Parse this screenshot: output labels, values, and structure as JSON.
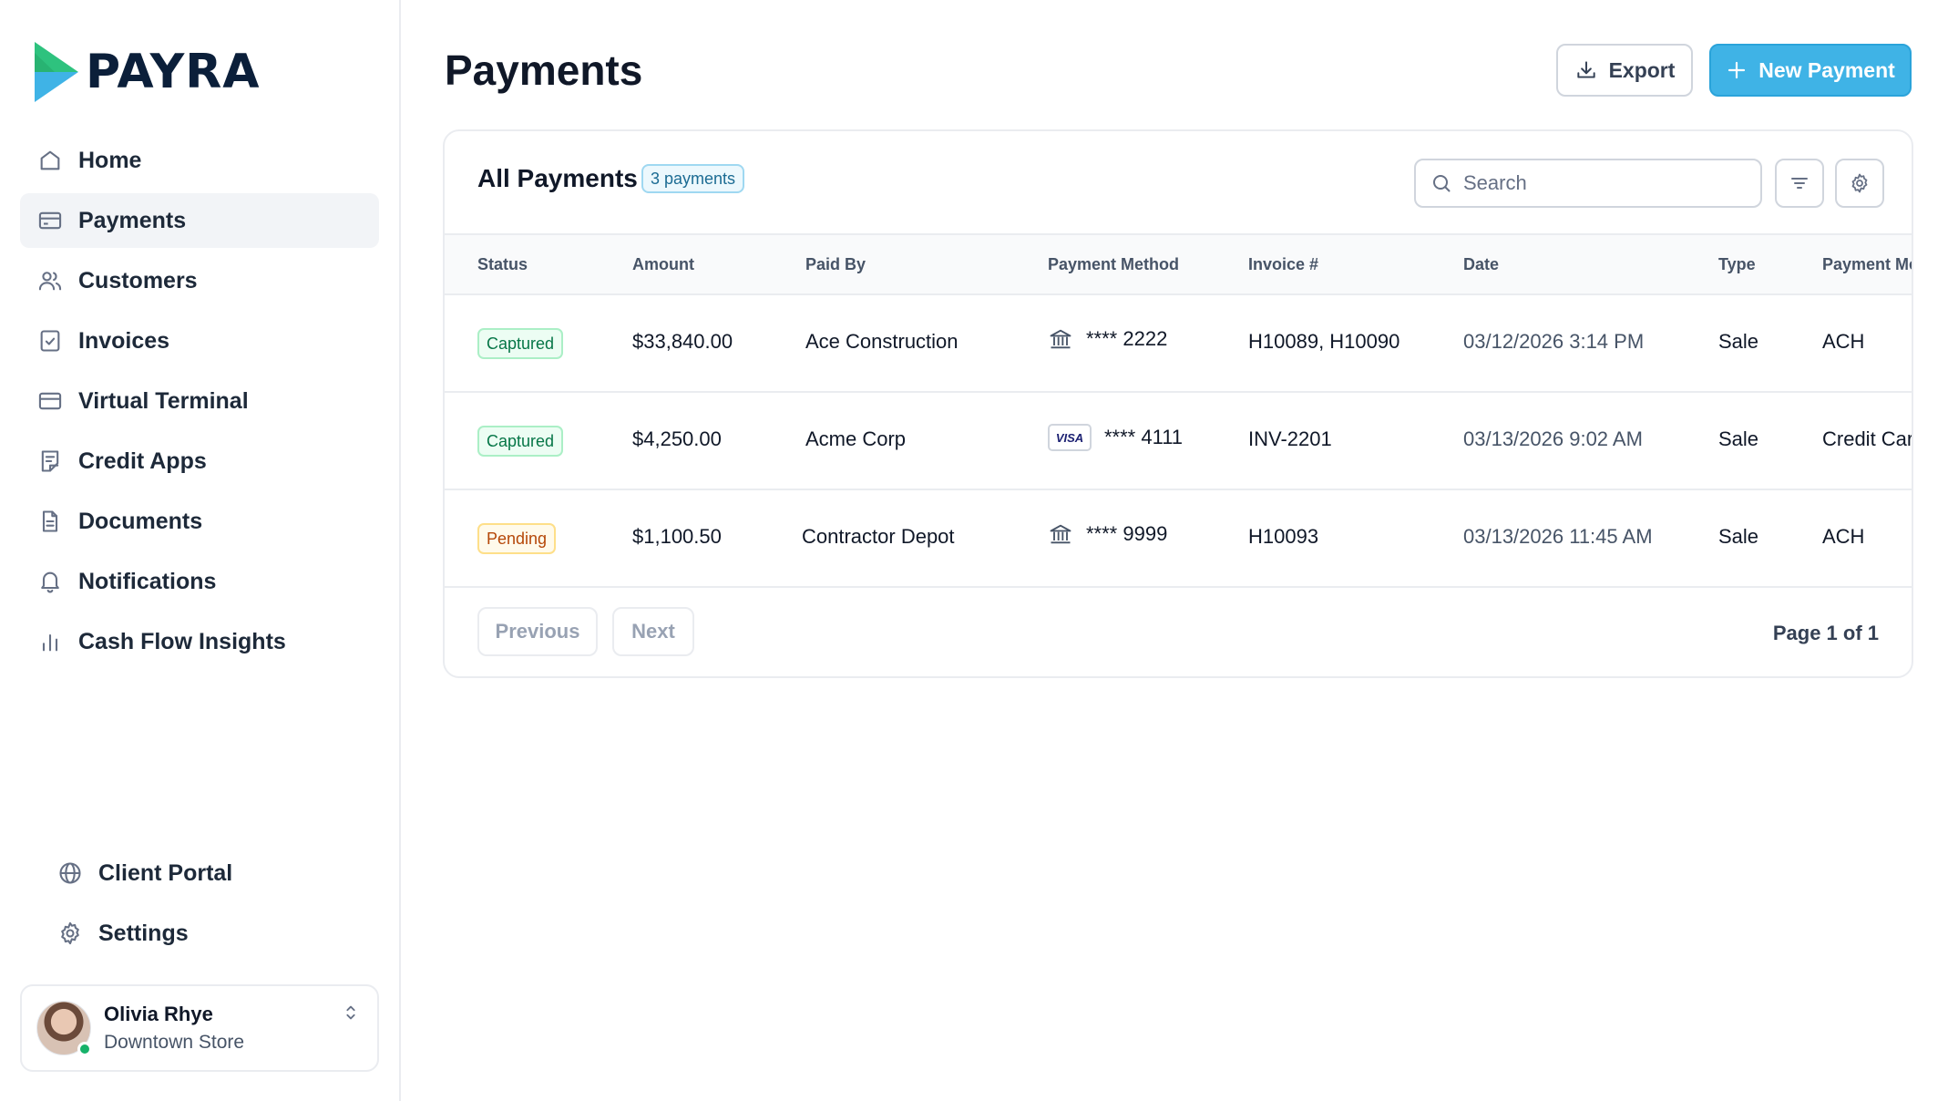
{
  "brand": {
    "name": "PAYRA",
    "accent": "#3fb3e6",
    "logo_green": "#2ec27e"
  },
  "sidebar": {
    "items": [
      {
        "label": "Home",
        "icon": "home-icon"
      },
      {
        "label": "Payments",
        "icon": "card-icon",
        "active": true
      },
      {
        "label": "Customers",
        "icon": "users-icon"
      },
      {
        "label": "Invoices",
        "icon": "invoice-check-icon"
      },
      {
        "label": "Virtual Terminal",
        "icon": "terminal-card-icon"
      },
      {
        "label": "Credit Apps",
        "icon": "credit-app-icon"
      },
      {
        "label": "Documents",
        "icon": "document-icon"
      },
      {
        "label": "Notifications",
        "icon": "bell-icon"
      },
      {
        "label": "Cash Flow Insights",
        "icon": "bar-chart-icon"
      }
    ],
    "bottom_items": [
      {
        "label": "Client Portal",
        "icon": "globe-icon"
      },
      {
        "label": "Settings",
        "icon": "gear-icon"
      }
    ],
    "user": {
      "name": "Olivia Rhye",
      "store": "Downtown Store",
      "status": "online"
    }
  },
  "header": {
    "title": "Payments",
    "export_label": "Export",
    "new_payment_label": "New Payment"
  },
  "table_card": {
    "title": "All Payments",
    "count_badge": "3 payments",
    "search_placeholder": "Search",
    "columns": [
      "Status",
      "Amount",
      "Paid By",
      "Payment Method",
      "Invoice #",
      "Date",
      "Type",
      "Payment Me"
    ],
    "rows": [
      {
        "status": "Captured",
        "status_kind": "captured",
        "amount": "$33,840.00",
        "paid_by": "Ace Construction",
        "method_icon": "bank-icon",
        "method": "**** 2222",
        "invoice": "H10089, H10090",
        "date": "03/12/2026 3:14 PM",
        "type": "Sale",
        "payment_method_type": "ACH"
      },
      {
        "status": "Captured",
        "status_kind": "captured",
        "amount": "$4,250.00",
        "paid_by": "Acme Corp",
        "method_icon": "visa-icon",
        "method_brand": "VISA",
        "method": "**** 4111",
        "invoice": "INV-2201",
        "date": "03/13/2026 9:02 AM",
        "type": "Sale",
        "payment_method_type": "Credit Car"
      },
      {
        "status": "Pending",
        "status_kind": "pending",
        "amount": "$1,100.50",
        "paid_by": "Contractor Depot",
        "method_icon": "bank-icon",
        "method": "**** 9999",
        "invoice": "H10093",
        "date": "03/13/2026 11:45 AM",
        "type": "Sale",
        "payment_method_type": "ACH"
      }
    ],
    "pagination": {
      "previous_label": "Previous",
      "next_label": "Next",
      "page_info": "Page 1 of 1"
    }
  }
}
